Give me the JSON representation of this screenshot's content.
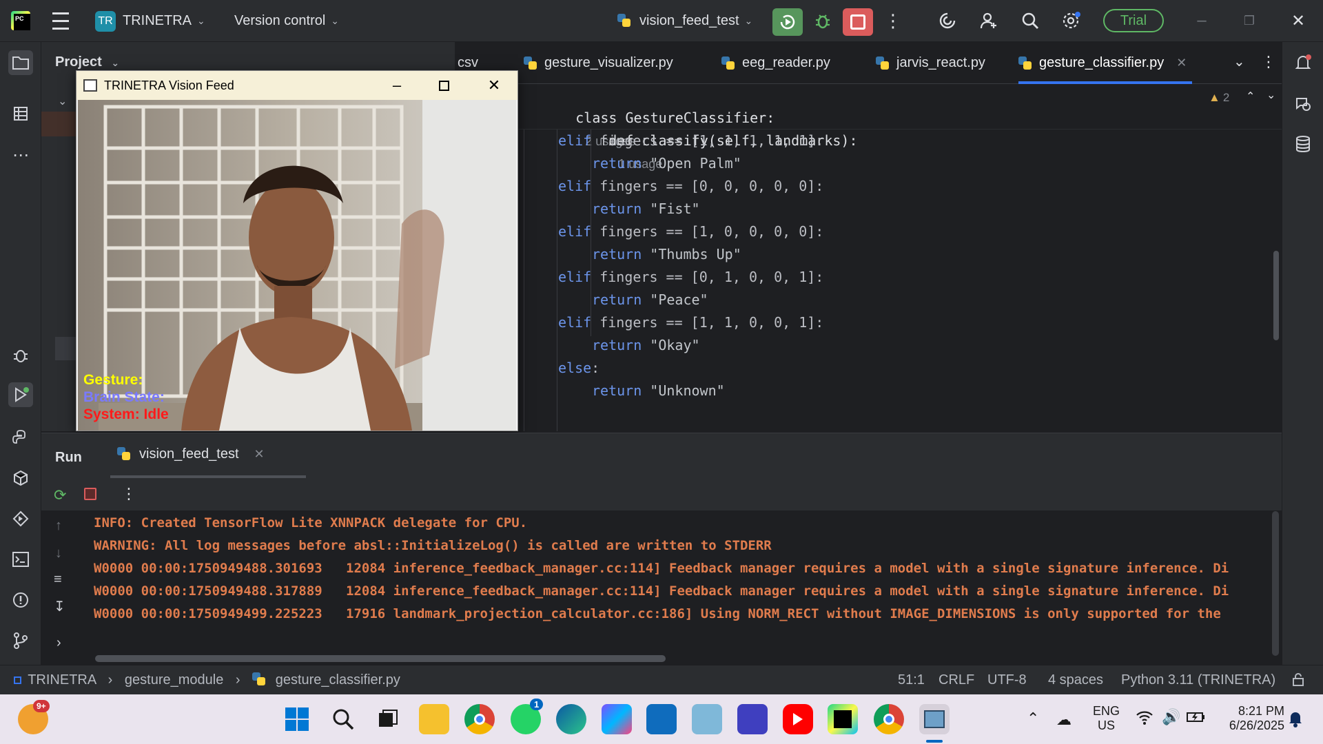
{
  "titlebar": {
    "project_badge": "TR",
    "project_name": "TRINETRA",
    "vcs_label": "Version control",
    "run_config": "vision_feed_test",
    "trial_label": "Trial"
  },
  "project_panel": {
    "title": "Project"
  },
  "editor": {
    "tabs": [
      {
        "label": "csv"
      },
      {
        "label": "gesture_visualizer.py"
      },
      {
        "label": "eeg_reader.py"
      },
      {
        "label": "jarvis_react.py"
      },
      {
        "label": "gesture_classifier.py"
      }
    ],
    "warnings_count": "2",
    "sticky_class": "class GestureClassifier:",
    "sticky_class_hint": "2 usages",
    "sticky_def": "def classify(self, landmarks):",
    "sticky_def_hint": "1 usage",
    "lines": [
      {
        "kw": "elif",
        "text": " fingers == [1, 1, 1, 1, 1]:"
      },
      {
        "kw": "return",
        "text": " \"Open Palm\""
      },
      {
        "kw": "elif",
        "text": " fingers == [0, 0, 0, 0, 0]:"
      },
      {
        "kw": "return",
        "text": " \"Fist\""
      },
      {
        "kw": "elif",
        "text": " fingers == [1, 0, 0, 0, 0]:"
      },
      {
        "kw": "return",
        "text": " \"Thumbs Up\""
      },
      {
        "kw": "elif",
        "text": " fingers == [0, 1, 0, 0, 1]:"
      },
      {
        "kw": "return",
        "text": " \"Peace\""
      },
      {
        "kw": "elif",
        "text": " fingers == [1, 1, 0, 0, 1]:"
      },
      {
        "kw": "return",
        "text": " \"Okay\""
      },
      {
        "kw": "else",
        "text": ":"
      },
      {
        "kw": "return",
        "text": " \"Unknown\""
      }
    ]
  },
  "vision_window": {
    "title": "TRINETRA Vision Feed",
    "overlay_gesture": "Gesture:",
    "overlay_brain": "Brain State:",
    "overlay_system": "System: Idle"
  },
  "run_panel": {
    "tab_run": "Run",
    "tab_config": "vision_feed_test",
    "logs": [
      "INFO: Created TensorFlow Lite XNNPACK delegate for CPU.",
      "WARNING: All log messages before absl::InitializeLog() is called are written to STDERR",
      "W0000 00:00:1750949488.301693   12084 inference_feedback_manager.cc:114] Feedback manager requires a model with a single signature inference. Di",
      "W0000 00:00:1750949488.317889   12084 inference_feedback_manager.cc:114] Feedback manager requires a model with a single signature inference. Di",
      "W0000 00:00:1750949499.225223   17916 landmark_projection_calculator.cc:186] Using NORM_RECT without IMAGE_DIMENSIONS is only supported for the"
    ]
  },
  "statusbar": {
    "crumb_project": "TRINETRA",
    "crumb_module": "gesture_module",
    "crumb_file": "gesture_classifier.py",
    "position": "51:1",
    "line_sep": "CRLF",
    "encoding": "UTF-8",
    "indent": "4 spaces",
    "interpreter": "Python 3.11 (TRINETRA)"
  },
  "taskbar": {
    "widgets_badge": "9+",
    "whatsapp_badge": "1",
    "lang_top": "ENG",
    "lang_bottom": "US",
    "time": "8:21 PM",
    "date": "6/26/2025"
  }
}
